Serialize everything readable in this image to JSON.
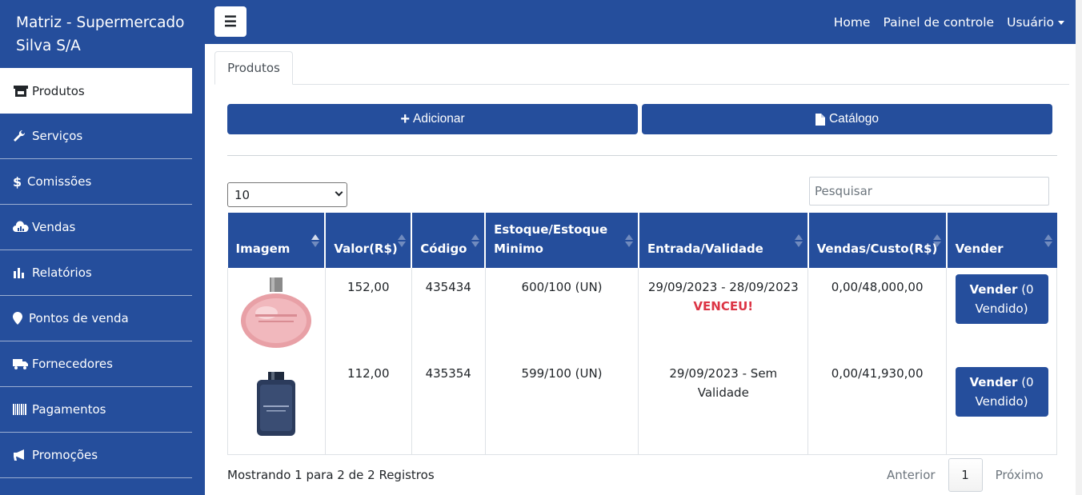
{
  "sidebar": {
    "brand": "Matriz - Supermercado Silva S/A",
    "items": [
      {
        "label": "Produtos",
        "icon": "store-icon"
      },
      {
        "label": "Serviços",
        "icon": "wrench-icon"
      },
      {
        "label": "Comissões",
        "icon": "dollar-icon"
      },
      {
        "label": "Vendas",
        "icon": "cloud-chart-icon"
      },
      {
        "label": "Relatórios",
        "icon": "bar-chart-icon"
      },
      {
        "label": "Pontos de venda",
        "icon": "map-marker-icon"
      },
      {
        "label": "Fornecedores",
        "icon": "truck-icon"
      },
      {
        "label": "Pagamentos",
        "icon": "barcode-icon"
      },
      {
        "label": "Promoções",
        "icon": "megaphone-icon"
      }
    ]
  },
  "topbar": {
    "toggle_icon": "menu-icon",
    "home": "Home",
    "panel": "Painel de controle",
    "user": "Usuário"
  },
  "tabs": [
    {
      "label": "Produtos"
    }
  ],
  "actions": {
    "add": "Adicionar",
    "catalog": "Catálogo"
  },
  "table_controls": {
    "page_size": "10",
    "search_placeholder": "Pesquisar"
  },
  "table": {
    "headers": [
      "Imagem",
      "Valor(R$)",
      "Código",
      "Estoque/Estoque Minimo",
      "Entrada/Validade",
      "Vendas/Custo(R$)",
      "Vender"
    ],
    "rows": [
      {
        "image": "pink perfume bottle",
        "valor": "152,00",
        "codigo": "435434",
        "estoque": "600/100 (UN)",
        "entrada": "29/09/2023 - 28/09/2023",
        "status": "VENCEU!",
        "vendas": "0,00/48,000,00",
        "vender_bold": "Vender",
        "vender_rest": "(0 Vendido)"
      },
      {
        "image": "dark blue perfume bottle",
        "valor": "112,00",
        "codigo": "435354",
        "estoque": "599/100 (UN)",
        "entrada": "29/09/2023 - Sem Validade",
        "status": "",
        "vendas": "0,00/41,930,00",
        "vender_bold": "Vender",
        "vender_rest": "(0 Vendido)"
      }
    ]
  },
  "footer": {
    "info": "Mostrando 1 para 2 de 2 Registros",
    "prev": "Anterior",
    "current": "1",
    "next": "Próximo"
  },
  "colors": {
    "primary": "#254e9c",
    "danger": "#dc3545"
  }
}
